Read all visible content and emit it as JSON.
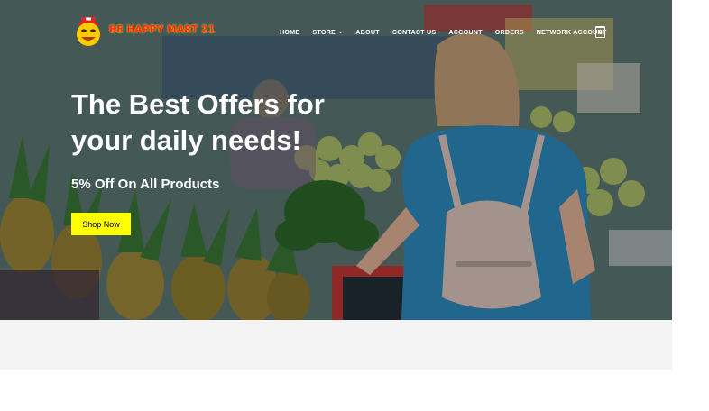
{
  "logo": {
    "text": "BE HAPPY MART 21"
  },
  "nav": {
    "items": [
      "HOME",
      "STORE",
      "ABOUT",
      "CONTACT US",
      "ACCOUNT",
      "ORDERS",
      "NETWORK ACCOUNT"
    ],
    "store_chevron": "⌄"
  },
  "cart": {
    "count": "0"
  },
  "hero": {
    "headline": "The Best Offers for your daily needs!",
    "subline": "5% Off On All Products",
    "cta_label": "Shop Now"
  },
  "colors": {
    "cta_bg": "#ffff00",
    "logo_red": "#ff2a1a",
    "logo_yellow": "#ffd200"
  },
  "icons": [
    "logo-mascot-icon",
    "cart-icon",
    "chevron-down-icon"
  ]
}
